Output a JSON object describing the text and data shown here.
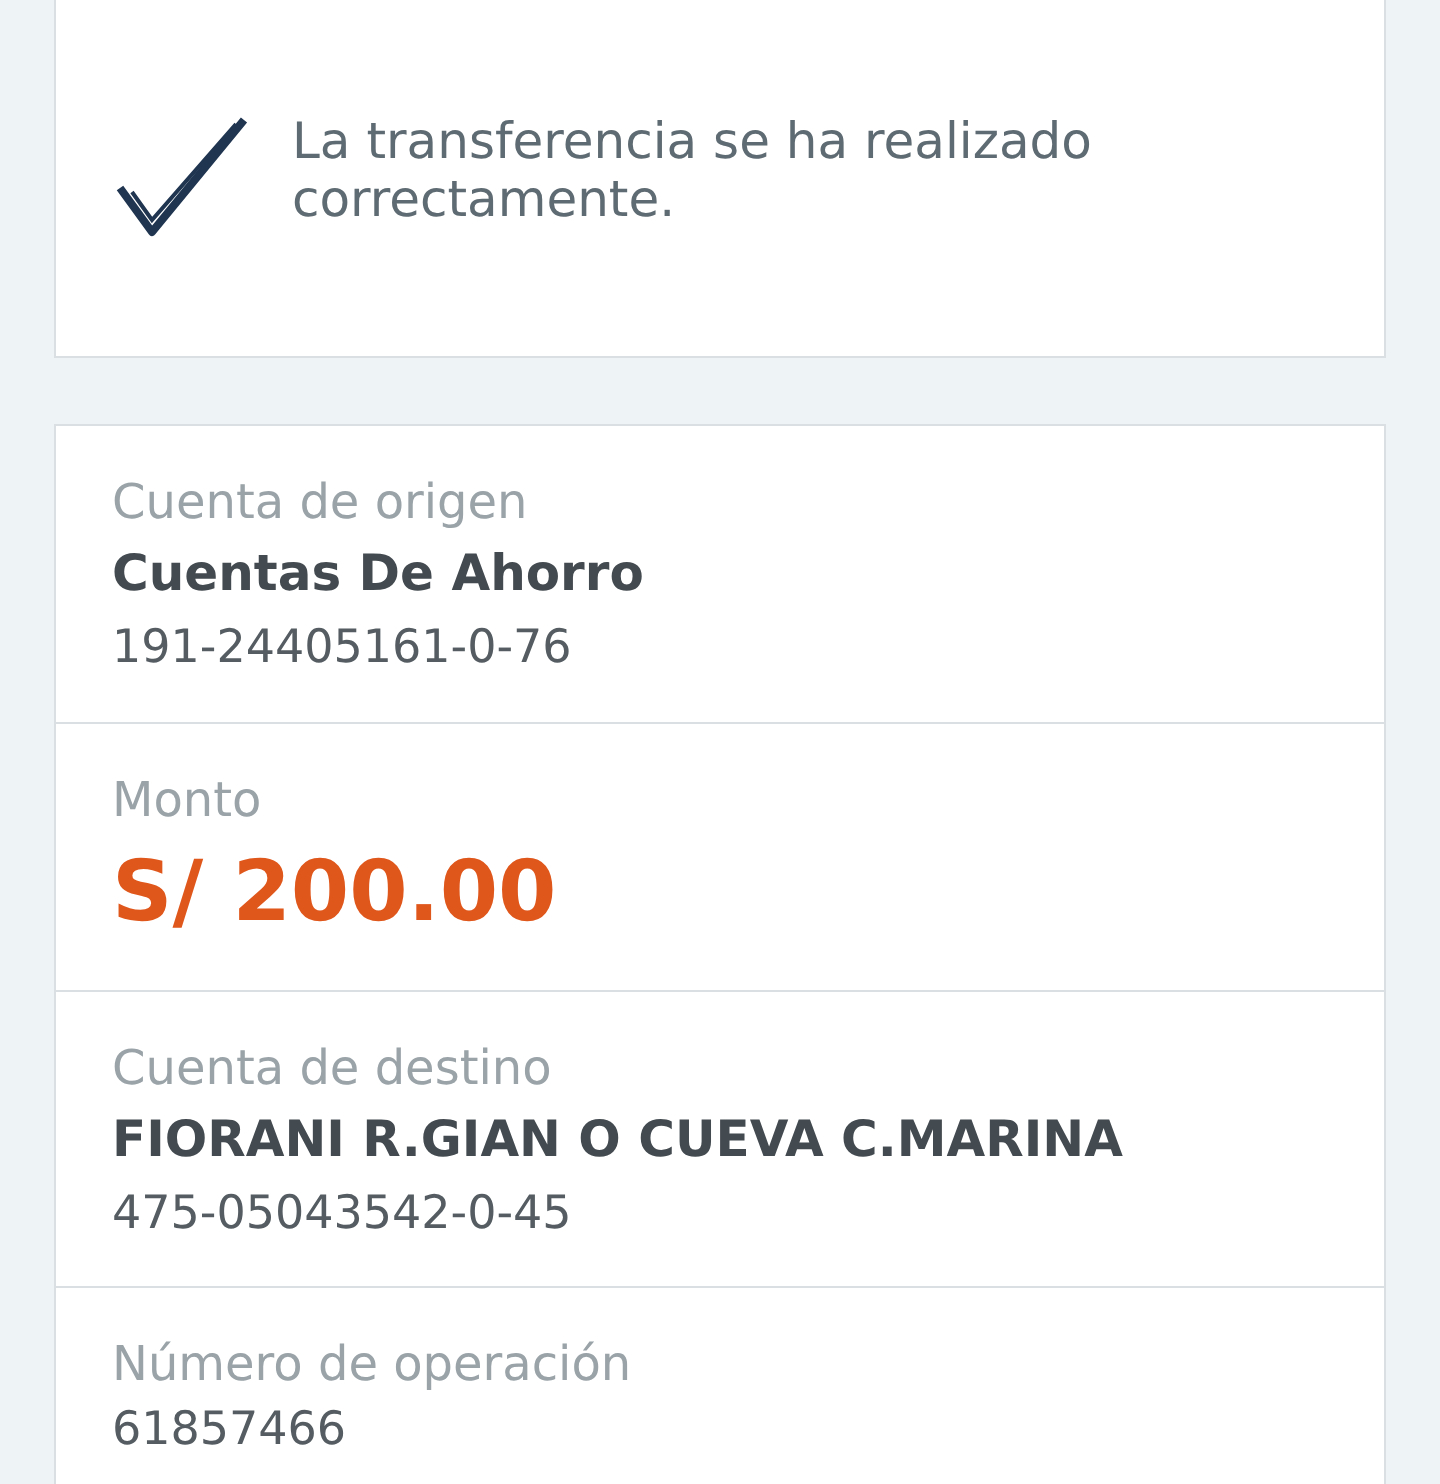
{
  "confirmation": {
    "message": "La transferencia se ha realizado correctamente."
  },
  "details": [
    {
      "kind": "account",
      "label": "Cuenta de origen",
      "name": "Cuentas De Ahorro",
      "number": "191-24405161-0-76"
    },
    {
      "kind": "amount",
      "label": "Monto",
      "amount": "S/ 200.00"
    },
    {
      "kind": "account",
      "label": "Cuenta de destino",
      "name": "FIORANI R.GIAN O CUEVA C.MARINA",
      "number": "475-05043542-0-45"
    },
    {
      "kind": "operation",
      "label": "Número de operación",
      "number": "61857466"
    }
  ]
}
